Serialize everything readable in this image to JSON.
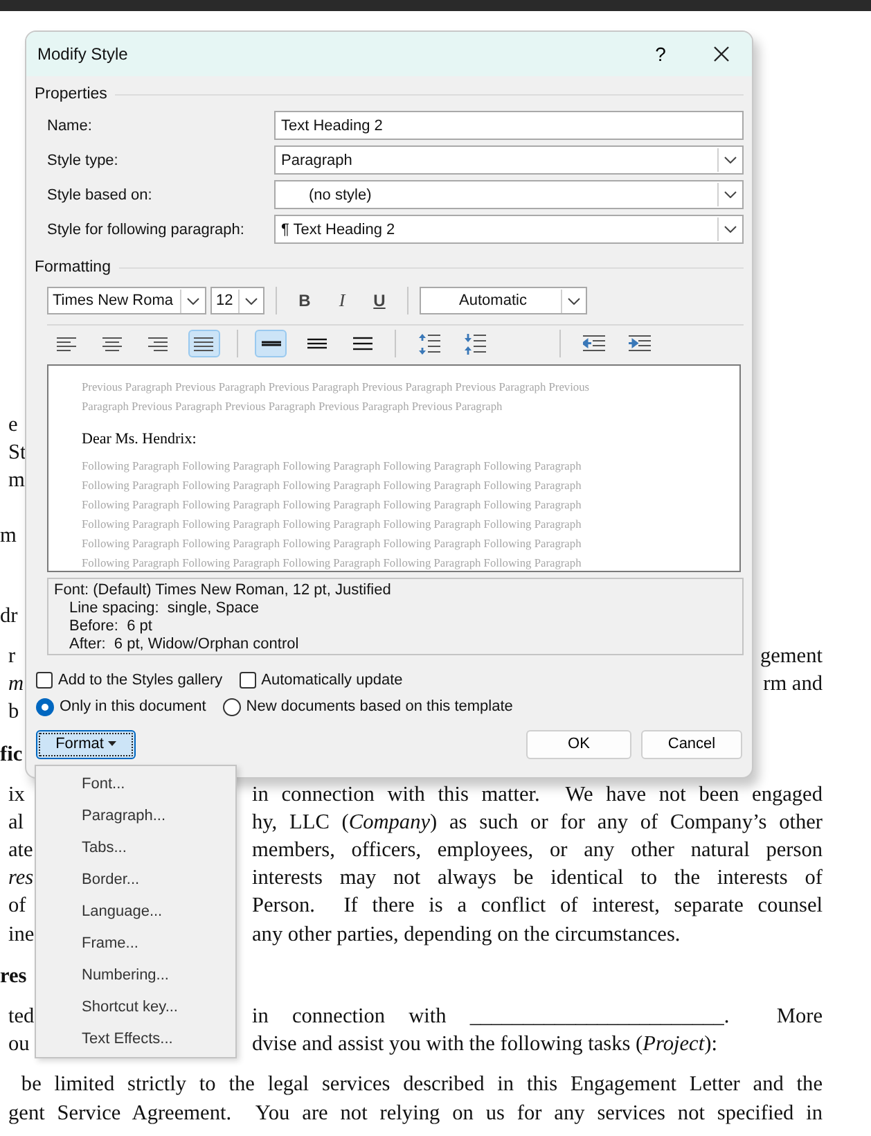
{
  "document": {
    "paragraphs": [
      {
        "kind": "body",
        "lines": [
          {
            "kind": "left-only",
            "left": "e"
          },
          {
            "kind": "left-only",
            "left": "St"
          },
          {
            "kind": "left-only",
            "left": "m"
          }
        ]
      },
      {
        "kind": "spaced",
        "lines": [
          {
            "kind": "left-only",
            "left": "m"
          }
        ]
      },
      {
        "kind": "wide-gap",
        "lines": [
          {
            "kind": "left-only",
            "left": "dr"
          }
        ]
      },
      {
        "kind": "body",
        "lines": [
          {
            "kind": "flush-right",
            "left": "r",
            "right": "gement"
          },
          {
            "kind": "flush-right",
            "left": "*m*",
            "right": "rm and"
          },
          {
            "kind": "left-only",
            "left": "b"
          }
        ]
      },
      {
        "kind": "heading",
        "lines": [
          {
            "kind": "left-only",
            "left": "fic"
          }
        ]
      },
      {
        "kind": "body",
        "lines": [
          {
            "kind": "justified",
            "left": "ix",
            "right": "in connection with this matter.  We have not been engaged"
          },
          {
            "kind": "justified",
            "left": "al",
            "right": "hy, LLC (*Company*) as such or for any of Company’s other"
          },
          {
            "kind": "justified",
            "left": "ate",
            "right": "members, officers, employees, or any other natural person"
          },
          {
            "kind": "justified",
            "left": "*res*",
            "right": "interests may not always be identical to the interests of"
          },
          {
            "kind": "justified",
            "left": "of",
            "right": "Person.  If there is a conflict of interest, separate counsel"
          },
          {
            "kind": "end",
            "left": "ine",
            "right": "any other parties, depending on the circumstances."
          }
        ]
      },
      {
        "kind": "heading",
        "lines": [
          {
            "kind": "left-only",
            "left": "res"
          }
        ]
      },
      {
        "kind": "body",
        "lines": [
          {
            "kind": "justified",
            "left": "ted",
            "right": "in connection with ________________________.  More"
          },
          {
            "kind": "end",
            "left": "ou",
            "right": "dvise and assist you with the following tasks (*Project*):"
          }
        ]
      },
      {
        "kind": "body",
        "lines": [
          {
            "kind": "full",
            "left": " be limited strictly to the legal services described in this Engagement Letter and the"
          },
          {
            "kind": "full",
            "left": "gent Service Agreement.  You are not relying on us for any services not specified in"
          }
        ]
      }
    ]
  },
  "window": {
    "title": "Modify Style",
    "help": "?"
  },
  "properties": {
    "heading": "Properties",
    "fields": [
      {
        "label": "Name:",
        "kind": "text",
        "value": "Text Heading 2"
      },
      {
        "label": "Style type:",
        "kind": "dropdown",
        "value": "Paragraph"
      },
      {
        "label": "Style based on:",
        "kind": "style-dropdown",
        "value": "(no style)"
      },
      {
        "label": "Style for following paragraph:",
        "kind": "dropdown",
        "value": "¶ Text Heading 2"
      }
    ]
  },
  "formatting": {
    "heading": "Formatting",
    "font": "Times New Roma",
    "size": "12",
    "style_buttons": [
      {
        "kind": "bold",
        "label": "B"
      },
      {
        "kind": "italic",
        "label": "I"
      },
      {
        "kind": "underline",
        "label": "U"
      }
    ],
    "color_setting": "Automatic",
    "alignment": [
      {
        "kind": "left",
        "selected": false
      },
      {
        "kind": "center",
        "selected": false
      },
      {
        "kind": "right",
        "selected": false
      },
      {
        "kind": "justify",
        "selected": true
      }
    ],
    "line_spacing": [
      {
        "kind": "single",
        "selected": true
      },
      {
        "kind": "one-half",
        "selected": false
      },
      {
        "kind": "double",
        "selected": false
      }
    ],
    "paragraph_spacing": [
      {
        "kind": "increase",
        "selected": false
      },
      {
        "kind": "decrease",
        "selected": false
      }
    ],
    "indent": [
      {
        "kind": "decrease",
        "selected": false
      },
      {
        "kind": "increase",
        "selected": false
      }
    ]
  },
  "preview": {
    "previous_lines": [
      "Previous Paragraph Previous Paragraph Previous Paragraph Previous Paragraph Previous Paragraph Previous",
      "Paragraph Previous Paragraph Previous Paragraph Previous Paragraph Previous Paragraph"
    ],
    "sample": "Dear Ms. Hendrix:",
    "following_lines": [
      "Following Paragraph Following Paragraph Following Paragraph Following Paragraph Following Paragraph",
      "Following Paragraph Following Paragraph Following Paragraph Following Paragraph Following Paragraph",
      "Following Paragraph Following Paragraph Following Paragraph Following Paragraph Following Paragraph",
      "Following Paragraph Following Paragraph Following Paragraph Following Paragraph Following Paragraph",
      "Following Paragraph Following Paragraph Following Paragraph Following Paragraph Following Paragraph",
      "Following Paragraph Following Paragraph Following Paragraph Following Paragraph Following Paragraph"
    ]
  },
  "description": [
    "Font: (Default) Times New Roman, 12 pt, Justified",
    "Line spacing:  single, Space",
    "Before:  6 pt",
    "After:  6 pt, Widow/Orphan control"
  ],
  "checkboxes": [
    {
      "label": "Add to the Styles gallery",
      "checked": false
    },
    {
      "label": "Automatically update",
      "checked": false
    }
  ],
  "radios": [
    {
      "label": "Only in this document",
      "selected": true
    },
    {
      "label": "New documents based on this template",
      "selected": false
    }
  ],
  "buttons": {
    "format": "Format",
    "ok": "OK",
    "cancel": "Cancel"
  },
  "format_menu": [
    "Font...",
    "Paragraph...",
    "Tabs...",
    "Border...",
    "Language...",
    "Frame...",
    "Numbering...",
    "Shortcut key...",
    "Text Effects..."
  ]
}
